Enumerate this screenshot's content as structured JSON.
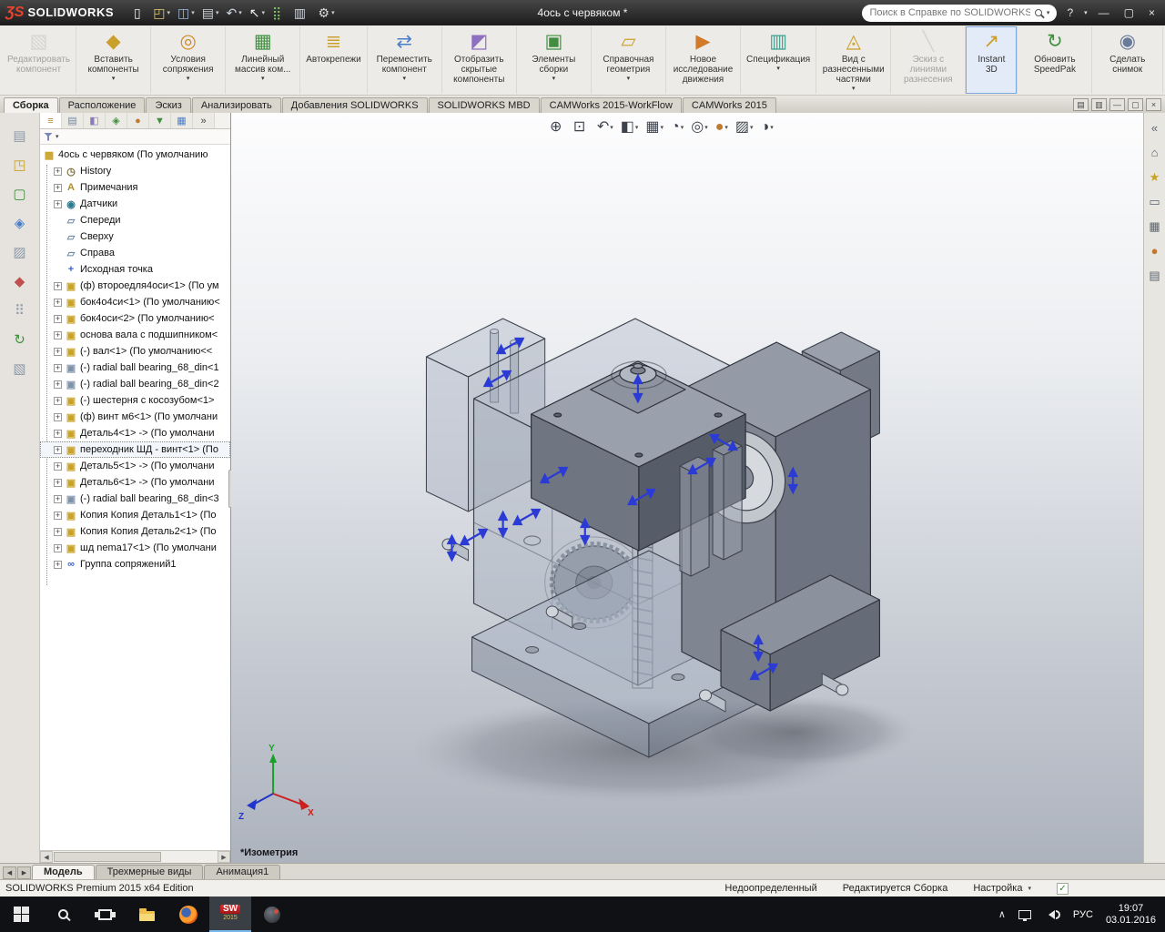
{
  "glyphs": {
    "caret": "▾",
    "plus": "+",
    "left": "◀",
    "right": "▶",
    "check": "✓"
  },
  "title_bar": {
    "logo_mark": "ƷS",
    "logo_text": "SOLIDWORKS",
    "document_title": "4ось с червяком *",
    "search_placeholder": "Поиск в Справке по SOLIDWORKS",
    "help_glyph": "?",
    "window_controls": [
      "—",
      "▢",
      "×"
    ],
    "quick_access": [
      {
        "name": "new-document-button",
        "glyph": "▯",
        "color": "#f0f0f0"
      },
      {
        "name": "open-button",
        "glyph": "◰",
        "color": "#e8c96a",
        "caret": true
      },
      {
        "name": "save-button",
        "glyph": "◫",
        "color": "#9db7d8",
        "caret": true
      },
      {
        "name": "print-button",
        "glyph": "▤",
        "color": "#cfd4da",
        "caret": true
      },
      {
        "name": "undo-button",
        "glyph": "↶",
        "color": "#cfd8e8",
        "caret": true
      },
      {
        "name": "select-button",
        "glyph": "↖",
        "color": "#f0f0f0",
        "caret": true
      },
      {
        "name": "rebuild-button",
        "glyph": "⣿",
        "color": "#7fbf5f"
      },
      {
        "name": "file-properties-button",
        "glyph": "▥",
        "color": "#cfd4da"
      },
      {
        "name": "options-button",
        "glyph": "⚙",
        "color": "#d8d8d8",
        "caret": true
      }
    ]
  },
  "ribbon": {
    "buttons": [
      {
        "name": "edit-component-button",
        "label": "Редактировать компонент",
        "glyph": "▧",
        "color": "#b9b9b9",
        "cls": "disabled"
      },
      {
        "name": "insert-components-button",
        "label": "Вставить компоненты",
        "glyph": "◆",
        "color": "#caa02c",
        "caret": true
      },
      {
        "name": "mate-button",
        "label": "Условия сопряжения",
        "glyph": "◎",
        "color": "#d08a2a",
        "caret": true
      },
      {
        "name": "linear-pattern-button",
        "label": "Линейный массив ком...",
        "glyph": "▦",
        "color": "#3f8f3f",
        "caret": true
      },
      {
        "name": "smart-fasteners-button",
        "label": "Автокрепежи",
        "glyph": "≣",
        "color": "#caa02c"
      },
      {
        "name": "move-component-button",
        "label": "Переместить компонент",
        "glyph": "⇄",
        "color": "#4a7ec8",
        "caret": true
      },
      {
        "name": "show-hidden-components-button",
        "label": "Отобразить скрытые компоненты",
        "glyph": "◩",
        "color": "#8f6fc0"
      },
      {
        "name": "assembly-features-button",
        "label": "Элементы сборки",
        "glyph": "▣",
        "color": "#3f8f3f",
        "caret": true
      },
      {
        "name": "reference-geometry-button",
        "label": "Справочная геометрия",
        "glyph": "▱",
        "color": "#caa02c",
        "caret": true
      },
      {
        "name": "new-motion-study-button",
        "label": "Новое исследование движения",
        "glyph": "▶",
        "color": "#d07a2a"
      },
      {
        "name": "bill-of-materials-button",
        "label": "Спецификация",
        "glyph": "▥",
        "color": "#3f9f8f",
        "caret": true
      },
      {
        "name": "exploded-view-button",
        "label": "Вид с разнесенными частями",
        "glyph": "◬",
        "color": "#caa02c",
        "caret": true
      },
      {
        "name": "explode-line-sketch-button",
        "label": "Эскиз с линиями разнесения",
        "glyph": "╲",
        "color": "#b9b9b9",
        "cls": "disabled"
      },
      {
        "name": "instant-3d-button",
        "label": "Instant 3D",
        "glyph": "↗",
        "color": "#caa02c",
        "cls": "active"
      },
      {
        "name": "update-speedpak-button",
        "label": "Обновить SpeedPak",
        "glyph": "↻",
        "color": "#3f8f3f"
      },
      {
        "name": "take-snapshot-button",
        "label": "Сделать снимок",
        "glyph": "◉",
        "color": "#6a7a9a"
      }
    ]
  },
  "command_tabs": [
    {
      "name": "tab-assembly",
      "label": "Сборка",
      "cls": "active"
    },
    {
      "name": "tab-layout",
      "label": "Расположение"
    },
    {
      "name": "tab-sketch",
      "label": "Эскиз"
    },
    {
      "name": "tab-analyze",
      "label": "Анализировать"
    },
    {
      "name": "tab-solidworks-addins",
      "label": "Добавления SOLIDWORKS"
    },
    {
      "name": "tab-solidworks-mbd",
      "label": "SOLIDWORKS MBD"
    },
    {
      "name": "tab-camworks-workflow",
      "label": "CAMWorks 2015-WorkFlow"
    },
    {
      "name": "tab-camworks-2015",
      "label": "CAMWorks 2015"
    }
  ],
  "doc_window_controls": [
    {
      "name": "cm-pin-button",
      "glyph": "▤"
    },
    {
      "name": "cm-options-button",
      "glyph": "▥"
    },
    {
      "name": "doc-minimize-button",
      "glyph": "—"
    },
    {
      "name": "doc-restore-button",
      "glyph": "▢"
    },
    {
      "name": "doc-close-button",
      "glyph": "×"
    }
  ],
  "left_toolbar": [
    {
      "name": "left-toolbar-button-1",
      "glyph": "▤",
      "color": "#8f99a8"
    },
    {
      "name": "left-toolbar-button-2",
      "glyph": "◳",
      "color": "#c9a227"
    },
    {
      "name": "left-toolbar-button-3",
      "glyph": "▢",
      "color": "#3f8f3f"
    },
    {
      "name": "left-toolbar-button-4",
      "glyph": "◈",
      "color": "#4a7ec8"
    },
    {
      "name": "left-toolbar-button-5",
      "glyph": "▨",
      "color": "#8f99a8"
    },
    {
      "name": "left-toolbar-button-6",
      "glyph": "◆",
      "color": "#c05050"
    },
    {
      "name": "left-toolbar-button-7",
      "glyph": "⠿",
      "color": "#8f99a8"
    },
    {
      "name": "left-toolbar-button-8",
      "glyph": "↻",
      "color": "#3f8f3f"
    },
    {
      "name": "left-toolbar-button-9",
      "glyph": "▧",
      "color": "#8f99a8"
    }
  ],
  "panel_tabs": [
    {
      "name": "featuremanager-tab",
      "glyph": "≡",
      "color": "#b08c2a",
      "cls": "active"
    },
    {
      "name": "propertymanager-tab",
      "glyph": "▤",
      "color": "#6f87a8"
    },
    {
      "name": "configurationmanager-tab",
      "glyph": "◧",
      "color": "#8a7ab8"
    },
    {
      "name": "dimxpertmanager-tab",
      "glyph": "◈",
      "color": "#3f8f3f"
    },
    {
      "name": "displaymanager-tab",
      "glyph": "●",
      "color": "#c07a30"
    },
    {
      "name": "camworks-feature-tab",
      "glyph": "▼",
      "color": "#3f8f3f"
    },
    {
      "name": "camworks-operation-tab",
      "glyph": "▦",
      "color": "#4a7ec8"
    },
    {
      "name": "panel-overflow-button",
      "glyph": "»",
      "color": "#444444"
    }
  ],
  "feature_tree": {
    "items": [
      {
        "label": "4ось с червяком  (По умолчанию",
        "glyph": "▩",
        "color": "#c9a227",
        "cls": "root",
        "icon_name": "assembly-icon"
      },
      {
        "label": "History",
        "glyph": "◷",
        "color": "#7a6f3a",
        "plus": true,
        "icon_name": "history-folder-icon"
      },
      {
        "label": "Примечания",
        "glyph": "A",
        "color": "#b08c2a",
        "plus": true,
        "icon_name": "annotations-icon"
      },
      {
        "label": "Датчики",
        "glyph": "◉",
        "color": "#2a7a8f",
        "plus": true,
        "icon_name": "sensors-icon"
      },
      {
        "label": "Спереди",
        "glyph": "▱",
        "color": "#6f87a8",
        "icon_name": "plane-icon"
      },
      {
        "label": "Сверху",
        "glyph": "▱",
        "color": "#6f87a8",
        "icon_name": "plane-icon"
      },
      {
        "label": "Справа",
        "glyph": "▱",
        "color": "#6f87a8",
        "icon_name": "plane-icon"
      },
      {
        "label": "Исходная точка",
        "glyph": "+",
        "color": "#3a5fcd",
        "icon_name": "origin-icon"
      },
      {
        "label": "(ф) второедля4оси<1> (По ум",
        "glyph": "▣",
        "color": "#c9a227",
        "plus": true,
        "icon_name": "part-icon"
      },
      {
        "label": "бок4о4си<1> (По умолчанию<",
        "glyph": "▣",
        "color": "#c9a227",
        "plus": true,
        "icon_name": "part-icon"
      },
      {
        "label": "бок4оси<2> (По умолчанию<",
        "glyph": "▣",
        "color": "#c9a227",
        "plus": true,
        "icon_name": "part-icon"
      },
      {
        "label": "основа вала с подшипником<",
        "glyph": "▣",
        "color": "#c9a227",
        "plus": true,
        "icon_name": "part-icon"
      },
      {
        "label": "(-) вал<1> (По умолчанию<<",
        "glyph": "▣",
        "color": "#c9a227",
        "plus": true,
        "icon_name": "part-icon"
      },
      {
        "label": "(-) radial ball bearing_68_din<1",
        "glyph": "▣",
        "color": "#8093ad",
        "plus": true,
        "icon_name": "toolbox-part-icon"
      },
      {
        "label": "(-) radial ball bearing_68_din<2",
        "glyph": "▣",
        "color": "#8093ad",
        "plus": true,
        "icon_name": "toolbox-part-icon"
      },
      {
        "label": "(-) шестерня с косозубом<1>",
        "glyph": "▣",
        "color": "#c9a227",
        "plus": true,
        "icon_name": "part-icon"
      },
      {
        "label": "(ф) винт м6<1> (По умолчани",
        "glyph": "▣",
        "color": "#c9a227",
        "plus": true,
        "icon_name": "part-icon"
      },
      {
        "label": "Деталь4<1> -> (По умолчани",
        "glyph": "▣",
        "color": "#c9a227",
        "plus": true,
        "icon_name": "part-icon"
      },
      {
        "label": "переходник ШД - винт<1> (По",
        "glyph": "▣",
        "color": "#c9a227",
        "plus": true,
        "cls": "focus",
        "icon_name": "part-icon"
      },
      {
        "label": "Деталь5<1> -> (По умолчани",
        "glyph": "▣",
        "color": "#c9a227",
        "plus": true,
        "icon_name": "part-icon"
      },
      {
        "label": "Деталь6<1> -> (По умолчани",
        "glyph": "▣",
        "color": "#c9a227",
        "plus": true,
        "icon_name": "part-icon"
      },
      {
        "label": "(-) radial ball bearing_68_din<3",
        "glyph": "▣",
        "color": "#8093ad",
        "plus": true,
        "icon_name": "toolbox-part-icon"
      },
      {
        "label": "Копия Копия Деталь1<1> (По",
        "glyph": "▣",
        "color": "#c9a227",
        "plus": true,
        "icon_name": "part-icon"
      },
      {
        "label": "Копия Копия Деталь2<1> (По",
        "glyph": "▣",
        "color": "#c9a227",
        "plus": true,
        "icon_name": "part-icon"
      },
      {
        "label": "шд nema17<1> (По умолчани",
        "glyph": "▣",
        "color": "#c9a227",
        "plus": true,
        "icon_name": "part-icon"
      },
      {
        "label": "Группа сопряжений1",
        "glyph": "∞",
        "color": "#3a5fcd",
        "plus": true,
        "icon_name": "mates-group-icon"
      }
    ]
  },
  "view_toolbar": [
    {
      "name": "zoom-to-fit-button",
      "glyph": "⊕"
    },
    {
      "name": "zoom-to-area-button",
      "glyph": "⊡"
    },
    {
      "name": "previous-view-button",
      "glyph": "↶",
      "caret": true
    },
    {
      "name": "section-view-button",
      "glyph": "◧",
      "caret": true
    },
    {
      "name": "view-orientation-button",
      "glyph": "▦",
      "caret": true
    },
    {
      "name": "display-style-button",
      "glyph": "◔",
      "caret": true
    },
    {
      "name": "hide-show-items-button",
      "glyph": "◎",
      "caret": true
    },
    {
      "name": "edit-appearance-button",
      "glyph": "●",
      "color": "#c07a30",
      "caret": true
    },
    {
      "name": "apply-scene-button",
      "glyph": "▨",
      "caret": true
    },
    {
      "name": "view-settings-button",
      "glyph": "◑",
      "caret": true
    }
  ],
  "viewport": {
    "view_label": "*Изометрия",
    "triad": [
      "Y",
      "X",
      "Z"
    ]
  },
  "task_pane": [
    {
      "name": "taskpane-collapse-button",
      "glyph": "«",
      "color": "#5a6470"
    },
    {
      "name": "resources-home-button",
      "glyph": "⌂",
      "color": "#5a6470"
    },
    {
      "name": "design-library-button",
      "glyph": "★",
      "color": "#c9a227"
    },
    {
      "name": "file-explorer-button",
      "glyph": "▭",
      "color": "#5a6470"
    },
    {
      "name": "view-palette-button",
      "glyph": "▦",
      "color": "#5a6470"
    },
    {
      "name": "appearances-button",
      "glyph": "●",
      "color": "#c07a30"
    },
    {
      "name": "custom-properties-button",
      "glyph": "▤",
      "color": "#5a6470"
    }
  ],
  "doc_tab_controls": [
    {
      "name": "doc-tabs-scroll-left-button",
      "glyph": "◀"
    },
    {
      "name": "doc-tabs-scroll-right-button",
      "glyph": "▶"
    }
  ],
  "doc_tabs": [
    {
      "name": "tab-model",
      "label": "Модель",
      "cls": "active"
    },
    {
      "name": "tab-3d-views",
      "label": "Трехмерные виды"
    },
    {
      "name": "tab-animation1",
      "label": "Анимация1"
    }
  ],
  "status_bar": {
    "edition": "SOLIDWORKS Premium 2015 x64 Edition",
    "state": "Недоопределенный",
    "mode": "Редактируется Сборка",
    "custom": "Настройка"
  },
  "taskbar": {
    "chevron": "∧",
    "language": "РУС",
    "time": "19:07",
    "date": "03.01.2016",
    "sw_text": "SW",
    "sw_year": "2015"
  }
}
